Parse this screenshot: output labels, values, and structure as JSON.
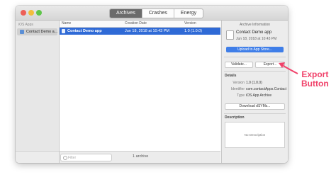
{
  "titlebar": {
    "tabs": [
      "Archives",
      "Crashes",
      "Energy"
    ],
    "active_tab": "Archives"
  },
  "sidebar": {
    "section": "iOS Apps",
    "items": [
      {
        "label": "Contact Demo a..."
      }
    ]
  },
  "table": {
    "columns": [
      "Name",
      "Creation Date",
      "Version"
    ],
    "rows": [
      {
        "name": "Contact Demo app",
        "date": "Jun 18, 2018 at 10:43 PM",
        "version": "1.0 (1.0.0)"
      }
    ]
  },
  "footer": {
    "filter_placeholder": "Filter",
    "count": "1 archive"
  },
  "inspector": {
    "title": "Archive Information",
    "archive_name": "Contact Demo app",
    "archive_date": "Jun 18, 2018 at 10:43 PM",
    "upload_label": "Upload to App Store...",
    "validate_label": "Validate...",
    "export_label": "Export...",
    "details_header": "Details",
    "details": [
      {
        "key": "Version",
        "value": "1.0 (1.0.0)"
      },
      {
        "key": "Identifier",
        "value": "com.contactApps.Contact"
      },
      {
        "key": "Type",
        "value": "iOS App Archive"
      }
    ],
    "dsym_label": "Download dSYMs...",
    "description_header": "Description",
    "description_placeholder": "No Description"
  },
  "annotation": {
    "line1": "Export",
    "line2": "Button",
    "color": "#f0426a"
  }
}
